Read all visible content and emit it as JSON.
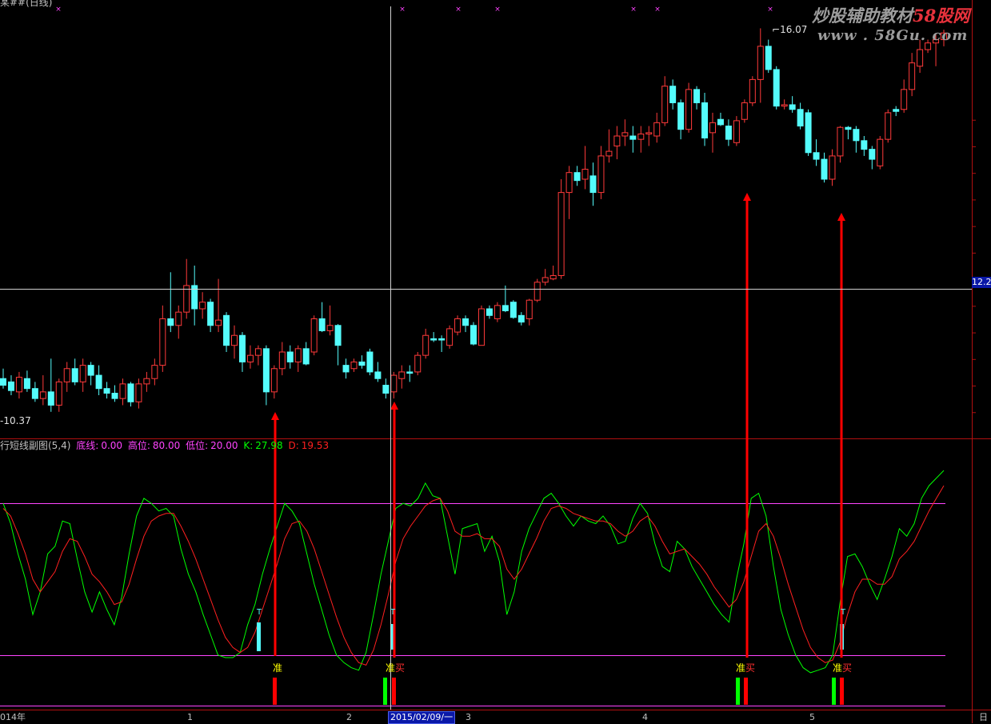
{
  "window_title": "某##(日线)",
  "watermark": {
    "main": "炒股辅助教材",
    "red_part": "58股网",
    "url": "www . 58Gu. com"
  },
  "price_labels": {
    "high": "16.07",
    "low": "10.37",
    "crosshair_price": "12.2"
  },
  "indicator": {
    "name": "行短线副图(5,4)",
    "params": [
      {
        "label": "底线:",
        "value": "0.00"
      },
      {
        "label": "高位:",
        "value": "80.00"
      },
      {
        "label": "低位:",
        "value": "20.00"
      },
      {
        "label": "K:",
        "value": "27.98"
      },
      {
        "label": "D:",
        "value": "19.53"
      }
    ]
  },
  "signal_labels": {
    "zhun": "准",
    "mai": "买",
    "t": "T"
  },
  "x_axis": {
    "labels": [
      "014年",
      "1",
      "2",
      "3",
      "4",
      "5",
      "日"
    ],
    "crosshair_date": "2015/02/09/一"
  },
  "colors": {
    "up": "#ff3a3a",
    "down": "#54fcfc",
    "k_line": "#00ff00",
    "d_line": "#ff2020",
    "level_line": "#ff44ff",
    "frame": "#b01010",
    "arrow": "#ff0000"
  },
  "chart_data": [
    {
      "type": "candlestick",
      "title": "某##(日线)",
      "ylim": [
        9.9,
        16.4
      ],
      "max_label": 16.07,
      "min_label": 10.37,
      "candles": [
        [
          10.8,
          10.95,
          10.65,
          10.7
        ],
        [
          10.75,
          10.85,
          10.55,
          10.62
        ],
        [
          10.6,
          10.9,
          10.5,
          10.82
        ],
        [
          10.8,
          10.92,
          10.6,
          10.65
        ],
        [
          10.65,
          10.75,
          10.45,
          10.5
        ],
        [
          10.5,
          10.85,
          10.4,
          10.6
        ],
        [
          10.6,
          11.1,
          10.3,
          10.4
        ],
        [
          10.4,
          10.8,
          10.3,
          10.75
        ],
        [
          10.75,
          11.05,
          10.6,
          10.95
        ],
        [
          10.95,
          11.1,
          10.7,
          10.75
        ],
        [
          10.75,
          11.1,
          10.6,
          11.0
        ],
        [
          11.0,
          11.05,
          10.7,
          10.85
        ],
        [
          10.85,
          11.0,
          10.55,
          10.65
        ],
        [
          10.65,
          10.75,
          10.5,
          10.58
        ],
        [
          10.58,
          10.7,
          10.45,
          10.5
        ],
        [
          10.5,
          10.8,
          10.4,
          10.72
        ],
        [
          10.72,
          10.75,
          10.38,
          10.45
        ],
        [
          10.45,
          10.8,
          10.35,
          10.72
        ],
        [
          10.72,
          10.9,
          10.6,
          10.8
        ],
        [
          10.8,
          11.1,
          10.7,
          11.0
        ],
        [
          11.0,
          11.9,
          10.9,
          11.7
        ],
        [
          11.7,
          12.4,
          11.5,
          11.6
        ],
        [
          11.6,
          11.9,
          11.4,
          11.8
        ],
        [
          11.8,
          12.6,
          11.7,
          12.2
        ],
        [
          12.2,
          12.5,
          11.6,
          11.85
        ],
        [
          11.85,
          12.1,
          11.7,
          11.95
        ],
        [
          11.95,
          12.0,
          11.5,
          11.6
        ],
        [
          11.6,
          12.3,
          11.5,
          11.68
        ],
        [
          11.75,
          11.8,
          11.2,
          11.3
        ],
        [
          11.3,
          11.6,
          11.1,
          11.45
        ],
        [
          11.45,
          11.5,
          10.9,
          11.05
        ],
        [
          11.05,
          11.3,
          10.95,
          11.15
        ],
        [
          11.15,
          11.3,
          11.0,
          11.25
        ],
        [
          11.25,
          11.3,
          10.4,
          10.6
        ],
        [
          10.6,
          11.0,
          10.5,
          10.95
        ],
        [
          10.95,
          11.35,
          10.85,
          11.2
        ],
        [
          11.2,
          11.3,
          10.95,
          11.05
        ],
        [
          11.05,
          11.3,
          10.9,
          11.25
        ],
        [
          11.25,
          11.35,
          11.0,
          11.02
        ],
        [
          11.2,
          11.75,
          11.15,
          11.7
        ],
        [
          11.7,
          11.95,
          11.5,
          11.52
        ],
        [
          11.52,
          11.9,
          11.45,
          11.6
        ],
        [
          11.6,
          11.62,
          11.0,
          11.3
        ],
        [
          11.0,
          11.1,
          10.8,
          10.9
        ],
        [
          10.95,
          11.1,
          10.9,
          11.05
        ],
        [
          11.05,
          11.15,
          10.95,
          11.0
        ],
        [
          11.2,
          11.25,
          10.85,
          10.9
        ],
        [
          10.9,
          11.05,
          10.75,
          10.8
        ],
        [
          10.7,
          10.8,
          10.5,
          10.58
        ],
        [
          10.6,
          10.9,
          10.5,
          10.85
        ],
        [
          10.8,
          11.0,
          10.65,
          10.9
        ],
        [
          10.9,
          11.0,
          10.75,
          10.88
        ],
        [
          10.9,
          11.2,
          10.85,
          11.15
        ],
        [
          11.15,
          11.55,
          11.1,
          11.45
        ],
        [
          11.4,
          11.5,
          11.35,
          11.38
        ],
        [
          11.4,
          11.45,
          11.2,
          11.38
        ],
        [
          11.3,
          11.6,
          11.25,
          11.55
        ],
        [
          11.5,
          11.75,
          11.45,
          11.7
        ],
        [
          11.7,
          11.75,
          11.5,
          11.6
        ],
        [
          11.6,
          11.65,
          11.3,
          11.32
        ],
        [
          11.3,
          11.9,
          11.3,
          11.85
        ],
        [
          11.85,
          11.9,
          11.7,
          11.75
        ],
        [
          11.7,
          11.95,
          11.65,
          11.9
        ],
        [
          11.9,
          12.2,
          11.8,
          11.82
        ],
        [
          11.95,
          11.98,
          11.7,
          11.72
        ],
        [
          11.75,
          11.8,
          11.6,
          11.65
        ],
        [
          11.7,
          12.0,
          11.6,
          11.98
        ],
        [
          11.98,
          12.3,
          11.95,
          12.25
        ],
        [
          12.25,
          12.45,
          12.2,
          12.32
        ],
        [
          12.3,
          12.5,
          12.28,
          12.35
        ],
        [
          12.35,
          13.8,
          12.3,
          13.6
        ],
        [
          13.6,
          14.0,
          13.2,
          13.9
        ],
        [
          13.9,
          14.0,
          13.7,
          13.78
        ],
        [
          13.8,
          14.3,
          13.65,
          13.95
        ],
        [
          13.85,
          14.05,
          13.4,
          13.6
        ],
        [
          13.6,
          14.3,
          13.5,
          14.15
        ],
        [
          14.15,
          14.55,
          14.05,
          14.22
        ],
        [
          14.3,
          14.6,
          14.1,
          14.45
        ],
        [
          14.45,
          14.7,
          14.3,
          14.5
        ],
        [
          14.45,
          14.6,
          14.2,
          14.4
        ],
        [
          14.4,
          14.6,
          14.2,
          14.48
        ],
        [
          14.48,
          14.6,
          14.3,
          14.5
        ],
        [
          14.45,
          14.8,
          14.35,
          14.65
        ],
        [
          14.65,
          15.35,
          14.6,
          15.2
        ],
        [
          15.2,
          15.3,
          14.85,
          14.95
        ],
        [
          14.95,
          15.0,
          14.4,
          14.55
        ],
        [
          14.55,
          15.25,
          14.5,
          15.15
        ],
        [
          15.15,
          15.2,
          14.85,
          14.95
        ],
        [
          14.95,
          15.1,
          14.3,
          14.42
        ],
        [
          14.5,
          14.8,
          14.2,
          14.65
        ],
        [
          14.7,
          14.8,
          14.6,
          14.62
        ],
        [
          14.6,
          14.7,
          14.3,
          14.4
        ],
        [
          14.35,
          14.75,
          14.3,
          14.68
        ],
        [
          14.7,
          15.0,
          14.65,
          14.95
        ],
        [
          14.95,
          15.35,
          14.9,
          15.3
        ],
        [
          15.3,
          16.07,
          14.95,
          15.8
        ],
        [
          15.8,
          15.9,
          15.4,
          15.45
        ],
        [
          15.45,
          15.5,
          14.85,
          14.9
        ],
        [
          14.9,
          15.0,
          14.85,
          14.92
        ],
        [
          14.92,
          15.05,
          14.8,
          14.85
        ],
        [
          14.85,
          14.95,
          14.55,
          14.6
        ],
        [
          14.8,
          14.85,
          14.15,
          14.2
        ],
        [
          14.2,
          14.4,
          14.0,
          14.1
        ],
        [
          14.1,
          14.2,
          13.75,
          13.8
        ],
        [
          13.8,
          14.25,
          13.7,
          14.15
        ],
        [
          14.15,
          14.6,
          14.05,
          14.58
        ],
        [
          14.58,
          14.6,
          14.4,
          14.55
        ],
        [
          14.55,
          14.6,
          14.2,
          14.38
        ],
        [
          14.38,
          14.45,
          14.15,
          14.25
        ],
        [
          14.25,
          14.3,
          13.95,
          14.1
        ],
        [
          14.0,
          14.45,
          13.95,
          14.4
        ],
        [
          14.4,
          14.85,
          14.35,
          14.8
        ],
        [
          14.85,
          14.9,
          14.75,
          14.82
        ],
        [
          14.85,
          15.3,
          14.8,
          15.15
        ],
        [
          15.15,
          15.7,
          15.05,
          15.55
        ],
        [
          15.5,
          15.9,
          15.4,
          15.75
        ],
        [
          15.75,
          15.9,
          15.7,
          15.85
        ],
        [
          15.85,
          16.0,
          15.5,
          15.9
        ],
        [
          15.9,
          16.05,
          15.8,
          16.0
        ]
      ]
    },
    {
      "type": "line",
      "title": "行短线副图(5,4)",
      "ylim": [
        0,
        100
      ],
      "levels": [
        0,
        20,
        80
      ],
      "series": [
        {
          "name": "K",
          "values": [
            80,
            72,
            60,
            50,
            36,
            45,
            60,
            63,
            73,
            72,
            58,
            45,
            37,
            45,
            38,
            32,
            43,
            60,
            75,
            82,
            80,
            77,
            78,
            75,
            62,
            52,
            45,
            36,
            28,
            20,
            19,
            19,
            21,
            32,
            40,
            52,
            62,
            71,
            80,
            77,
            72,
            60,
            48,
            38,
            28,
            20,
            17,
            15,
            14,
            21,
            36,
            52,
            65,
            78,
            80,
            79,
            82,
            88,
            83,
            82,
            67,
            52,
            70,
            71,
            72,
            61,
            67,
            57,
            36,
            45,
            61,
            70,
            76,
            82,
            84,
            80,
            75,
            71,
            75,
            73,
            72,
            75,
            71,
            64,
            65,
            74,
            80,
            76,
            64,
            55,
            53,
            65,
            62,
            55,
            50,
            45,
            40,
            36,
            33,
            50,
            64,
            82,
            84,
            75,
            55,
            38,
            28,
            20,
            15,
            13,
            14,
            15,
            20,
            41,
            59,
            60,
            55,
            48,
            42,
            50,
            59,
            70,
            67,
            72,
            82,
            87,
            90,
            93
          ]
        },
        {
          "name": "D",
          "values": [
            78,
            75,
            68,
            60,
            50,
            45,
            49,
            53,
            61,
            66,
            65,
            59,
            52,
            49,
            45,
            40,
            41,
            48,
            58,
            67,
            73,
            75,
            76,
            76,
            71,
            65,
            58,
            50,
            42,
            34,
            27,
            23,
            21,
            23,
            29,
            38,
            47,
            56,
            66,
            72,
            73,
            69,
            62,
            53,
            44,
            35,
            27,
            21,
            17,
            16,
            22,
            32,
            44,
            57,
            66,
            71,
            75,
            79,
            81,
            82,
            77,
            69,
            67,
            67,
            68,
            66,
            66,
            63,
            54,
            50,
            54,
            60,
            66,
            73,
            78,
            79,
            78,
            76,
            75,
            74,
            73,
            73,
            72,
            69,
            67,
            69,
            73,
            75,
            71,
            65,
            60,
            61,
            62,
            59,
            56,
            52,
            47,
            43,
            39,
            42,
            49,
            59,
            69,
            72,
            67,
            58,
            48,
            39,
            30,
            23,
            19,
            17,
            18,
            25,
            36,
            45,
            50,
            50,
            48,
            48,
            51,
            58,
            61,
            65,
            71,
            77,
            82,
            87
          ]
        }
      ]
    }
  ]
}
